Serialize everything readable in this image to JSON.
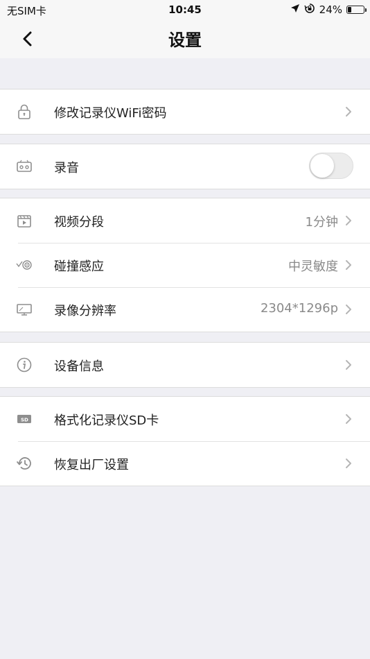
{
  "status_bar": {
    "carrier": "无SIM卡",
    "time": "10:45",
    "battery_percent": "24%",
    "battery_level": 0.24
  },
  "nav": {
    "title": "设置",
    "back_icon": "chevron-left-icon"
  },
  "groups": [
    {
      "items": [
        {
          "label": "修改记录仪WiFi密码",
          "icon": "lock-icon"
        }
      ]
    },
    {
      "items": [
        {
          "label": "录音",
          "icon": "recorder-icon",
          "toggle": false
        }
      ]
    },
    {
      "items": [
        {
          "label": "视频分段",
          "value": "1分钟",
          "icon": "video-icon"
        },
        {
          "label": "碰撞感应",
          "value": "中灵敏度",
          "icon": "sensor-icon"
        },
        {
          "label": "录像分辨率",
          "value": "2304*1296p",
          "icon": "monitor-icon"
        }
      ]
    },
    {
      "items": [
        {
          "label": "设备信息",
          "icon": "info-icon"
        }
      ]
    },
    {
      "items": [
        {
          "label": "格式化记录仪SD卡",
          "icon": "sd-card-icon"
        },
        {
          "label": "恢复出厂设置",
          "icon": "history-icon"
        }
      ]
    }
  ],
  "colors": {
    "background": "#efeff4",
    "nav_background": "#f7f7f7",
    "icon": "#8e8e8e",
    "value_text": "#8a8a8a"
  }
}
